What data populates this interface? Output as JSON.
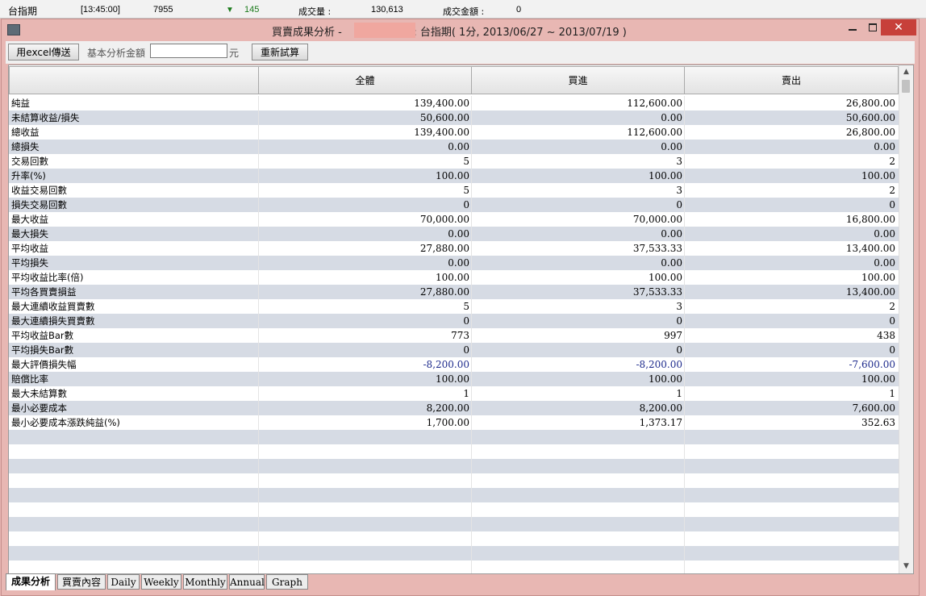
{
  "ticker": {
    "name": "台指期",
    "time": "[13:45:00]",
    "price": "7955",
    "change": "145",
    "volume_label": "成交量 :",
    "volume": "130,613",
    "amount_label": "成交金額 :",
    "amount": "0"
  },
  "window": {
    "title_prefix": "買賣成果分析 -",
    "title_suffix": "`: 台指期( 1分, 2013/06/27 ~ 2013/07/19 )",
    "close_glyph": "✕"
  },
  "toolbar": {
    "excel_button": "用excel傳送",
    "base_amount_label": "基本分析金額",
    "base_amount_value": "",
    "unit_label": "元",
    "recalc_button": "重新試算"
  },
  "table": {
    "columns": [
      "",
      "全體",
      "買進",
      "賣出"
    ],
    "rows": [
      [
        "純益",
        "139,400.00",
        "112,600.00",
        "26,800.00"
      ],
      [
        "未結算收益/損失",
        "50,600.00",
        "0.00",
        "50,600.00"
      ],
      [
        "總收益",
        "139,400.00",
        "112,600.00",
        "26,800.00"
      ],
      [
        "總損失",
        "0.00",
        "0.00",
        "0.00"
      ],
      [
        "交易回數",
        "5",
        "3",
        "2"
      ],
      [
        "升率(%)",
        "100.00",
        "100.00",
        "100.00"
      ],
      [
        "收益交易回數",
        "5",
        "3",
        "2"
      ],
      [
        "損失交易回數",
        "0",
        "0",
        "0"
      ],
      [
        "最大收益",
        "70,000.00",
        "70,000.00",
        "16,800.00"
      ],
      [
        "最大損失",
        "0.00",
        "0.00",
        "0.00"
      ],
      [
        "平均收益",
        "27,880.00",
        "37,533.33",
        "13,400.00"
      ],
      [
        "平均損失",
        "0.00",
        "0.00",
        "0.00"
      ],
      [
        "平均收益比率(倍)",
        "100.00",
        "100.00",
        "100.00"
      ],
      [
        "平均各買賣損益",
        "27,880.00",
        "37,533.33",
        "13,400.00"
      ],
      [
        "最大連續收益買賣數",
        "5",
        "3",
        "2"
      ],
      [
        "最大連續損失買賣數",
        "0",
        "0",
        "0"
      ],
      [
        "平均收益Bar數",
        "773",
        "997",
        "438"
      ],
      [
        "平均損失Bar數",
        "0",
        "0",
        "0"
      ],
      [
        "最大評價損失幅",
        "-8,200.00",
        "-8,200.00",
        "-7,600.00"
      ],
      [
        "賠償比率",
        "100.00",
        "100.00",
        "100.00"
      ],
      [
        "最大未結算數",
        "1",
        "1",
        "1"
      ],
      [
        "最小必要成本",
        "8,200.00",
        "8,200.00",
        "7,600.00"
      ],
      [
        "最小必要成本漲跌純益(%)",
        "1,700.00",
        "1,373.17",
        "352.63"
      ]
    ],
    "negative_color": "#1d2a8c"
  },
  "tabs": [
    {
      "label": "成果分析",
      "active": true
    },
    {
      "label": "買賣內容",
      "active": false
    },
    {
      "label": "Daily",
      "active": false
    },
    {
      "label": "Weekly",
      "active": false
    },
    {
      "label": "Monthly",
      "active": false
    },
    {
      "label": "Annual",
      "active": false
    },
    {
      "label": "Graph",
      "active": false
    }
  ]
}
